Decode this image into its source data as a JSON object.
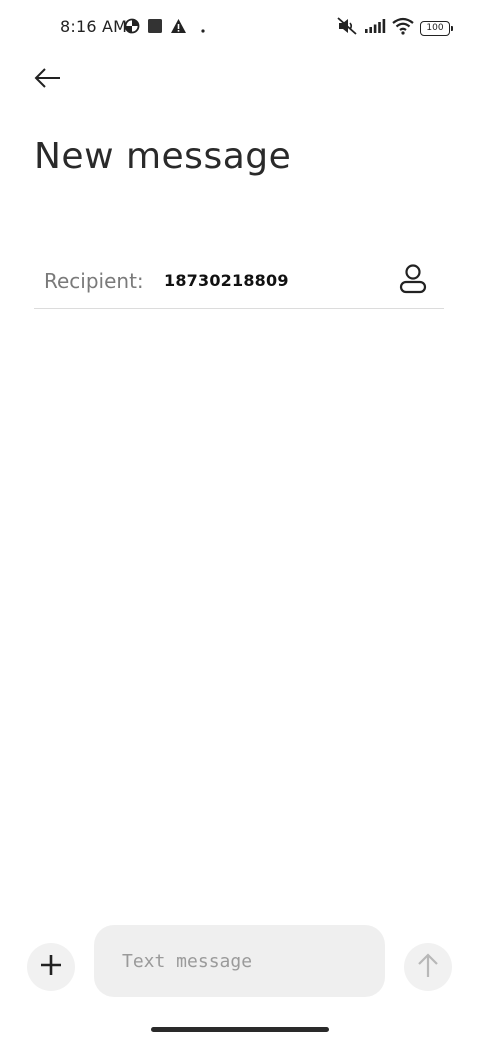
{
  "status_bar": {
    "time": "8:16 AM",
    "battery": "100",
    "icons": [
      "data-saver-icon",
      "square-notification-icon",
      "warning-icon",
      "dot-icon",
      "mute-icon",
      "signal-icon",
      "wifi-icon",
      "battery-icon"
    ]
  },
  "header": {
    "back_icon": "arrow-left-icon",
    "title": "New message"
  },
  "recipient": {
    "label": "Recipient:",
    "value": "18730218809",
    "contact_icon": "person-icon"
  },
  "composer": {
    "attach_icon": "plus-icon",
    "placeholder": "Text message",
    "value": "",
    "send_icon": "arrow-up-icon"
  }
}
